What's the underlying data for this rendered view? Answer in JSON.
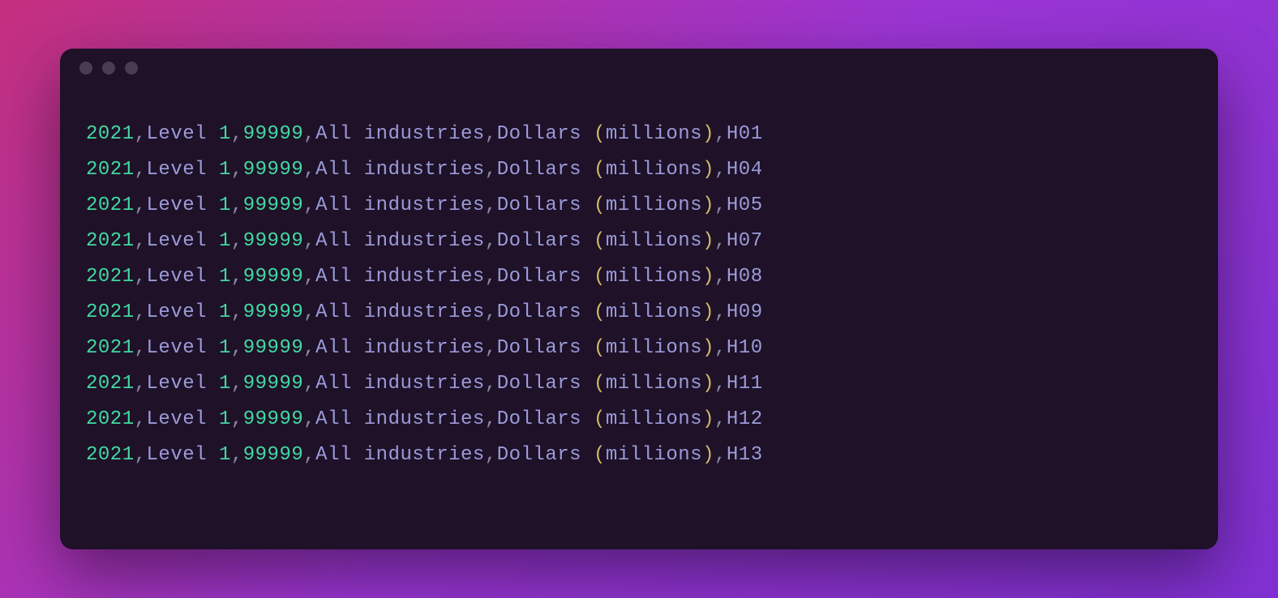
{
  "lines": [
    {
      "year": "2021",
      "level_word": "Level",
      "level_num": "1",
      "code": "99999",
      "industry": "All industries",
      "unit_word": "Dollars",
      "unit_paren": "millions",
      "suffix": "H01"
    },
    {
      "year": "2021",
      "level_word": "Level",
      "level_num": "1",
      "code": "99999",
      "industry": "All industries",
      "unit_word": "Dollars",
      "unit_paren": "millions",
      "suffix": "H04"
    },
    {
      "year": "2021",
      "level_word": "Level",
      "level_num": "1",
      "code": "99999",
      "industry": "All industries",
      "unit_word": "Dollars",
      "unit_paren": "millions",
      "suffix": "H05"
    },
    {
      "year": "2021",
      "level_word": "Level",
      "level_num": "1",
      "code": "99999",
      "industry": "All industries",
      "unit_word": "Dollars",
      "unit_paren": "millions",
      "suffix": "H07"
    },
    {
      "year": "2021",
      "level_word": "Level",
      "level_num": "1",
      "code": "99999",
      "industry": "All industries",
      "unit_word": "Dollars",
      "unit_paren": "millions",
      "suffix": "H08"
    },
    {
      "year": "2021",
      "level_word": "Level",
      "level_num": "1",
      "code": "99999",
      "industry": "All industries",
      "unit_word": "Dollars",
      "unit_paren": "millions",
      "suffix": "H09"
    },
    {
      "year": "2021",
      "level_word": "Level",
      "level_num": "1",
      "code": "99999",
      "industry": "All industries",
      "unit_word": "Dollars",
      "unit_paren": "millions",
      "suffix": "H10"
    },
    {
      "year": "2021",
      "level_word": "Level",
      "level_num": "1",
      "code": "99999",
      "industry": "All industries",
      "unit_word": "Dollars",
      "unit_paren": "millions",
      "suffix": "H11"
    },
    {
      "year": "2021",
      "level_word": "Level",
      "level_num": "1",
      "code": "99999",
      "industry": "All industries",
      "unit_word": "Dollars",
      "unit_paren": "millions",
      "suffix": "H12"
    },
    {
      "year": "2021",
      "level_word": "Level",
      "level_num": "1",
      "code": "99999",
      "industry": "All industries",
      "unit_word": "Dollars",
      "unit_paren": "millions",
      "suffix": "H13"
    }
  ]
}
